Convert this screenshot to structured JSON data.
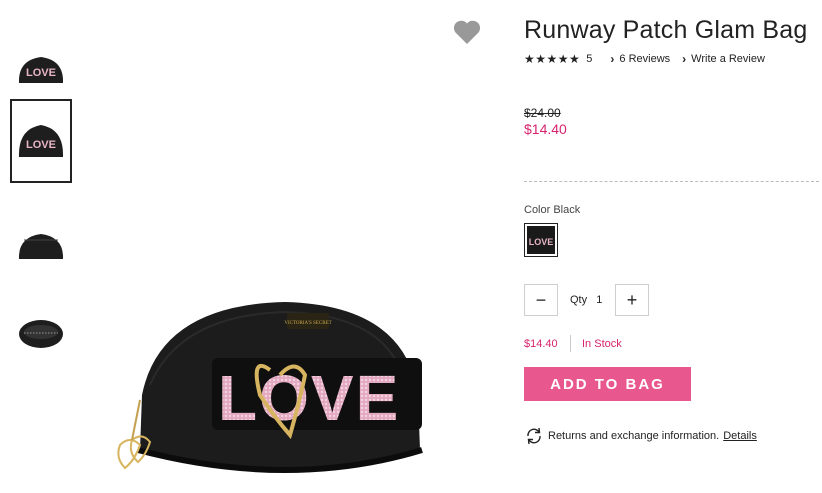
{
  "product": {
    "title": "Runway Patch Glam Bag",
    "rating_stars": "★★★★★",
    "rating_value": "5",
    "reviews_link": "6 Reviews",
    "write_review_link": "Write a Review",
    "original_price": "$24.00",
    "sale_price": "$14.40",
    "color_label": "Color Black",
    "patch_text": "LOVE"
  },
  "quantity": {
    "label": "Qty",
    "value": "1",
    "minus": "−",
    "plus": "+"
  },
  "stock": {
    "price": "$14.40",
    "status": "In Stock"
  },
  "actions": {
    "add_to_bag": "ADD TO BAG",
    "returns_text": "Returns and exchange information.",
    "details_link": "Details"
  },
  "thumbnails": [
    {
      "name": "front-love"
    },
    {
      "name": "front-love-selected"
    },
    {
      "name": "back"
    },
    {
      "name": "open-top"
    }
  ],
  "colors": {
    "accent_pink": "#e9578f",
    "price_pink": "#d6246e",
    "bag_black": "#1a1a1a",
    "patch_pink": "#e8b4c8"
  },
  "icons": [
    "heart-icon",
    "chevron-right-icon",
    "refresh-icon",
    "minus-icon",
    "plus-icon"
  ]
}
